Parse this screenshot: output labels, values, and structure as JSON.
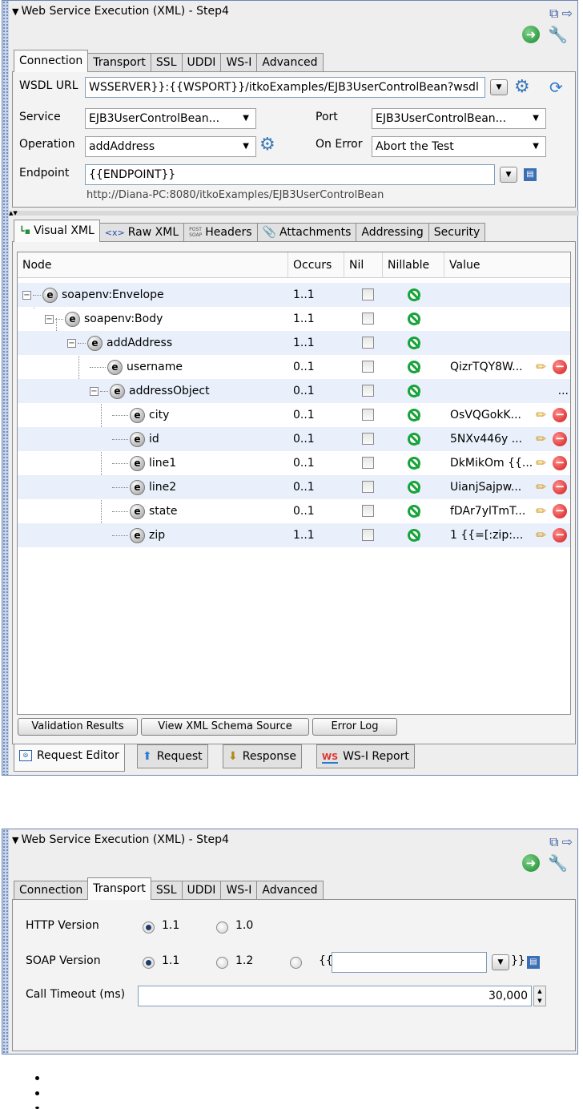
{
  "panel1": {
    "title": "Web Service Execution (XML) - Step4",
    "tabs": [
      "Connection",
      "Transport",
      "SSL",
      "UDDI",
      "WS-I",
      "Advanced"
    ],
    "active_tab": "Connection",
    "wsdl_label": "WSDL URL",
    "wsdl_value": "WSSERVER}}:{{WSPORT}}/itkoExamples/EJB3UserControlBean?wsdl",
    "service_label": "Service",
    "service_value": "EJB3UserControlBean...",
    "port_label": "Port",
    "port_value": "EJB3UserControlBean...",
    "operation_label": "Operation",
    "operation_value": "addAddress",
    "on_error_label": "On Error",
    "on_error_value": "Abort the Test",
    "endpoint_label": "Endpoint",
    "endpoint_value": "{{ENDPOINT}}",
    "endpoint_url": "http://Diana-PC:8080/itkoExamples/EJB3UserControlBean",
    "inner_tabs": [
      "Visual XML",
      "Raw XML",
      "Headers",
      "Attachments",
      "Addressing",
      "Security"
    ],
    "inner_tab_icons": {
      "raw_xml": "<x>",
      "headers_top": "POST",
      "headers_bottom": "SOAP"
    },
    "columns": [
      "Node",
      "Occurs",
      "Nil",
      "Nillable",
      "Value"
    ],
    "rows": [
      {
        "node": "soapenv:Envelope",
        "occurs": "1..1",
        "value": ""
      },
      {
        "node": "soapenv:Body",
        "occurs": "1..1",
        "value": ""
      },
      {
        "node": "addAddress",
        "occurs": "1..1",
        "value": ""
      },
      {
        "node": "username",
        "occurs": "0..1",
        "value": "QizrTQY8W..."
      },
      {
        "node": "addressObject",
        "occurs": "0..1",
        "value": "..."
      },
      {
        "node": "city",
        "occurs": "0..1",
        "value": "OsVQGokK..."
      },
      {
        "node": "id",
        "occurs": "0..1",
        "value": "5NXv446y ..."
      },
      {
        "node": "line1",
        "occurs": "0..1",
        "value": "DkMikOm {{..."
      },
      {
        "node": "line2",
        "occurs": "0..1",
        "value": "UianjSajpw..."
      },
      {
        "node": "state",
        "occurs": "0..1",
        "value": "fDAr7ylTmT..."
      },
      {
        "node": "zip",
        "occurs": "1..1",
        "value": "1 {{=[:zip:..."
      }
    ],
    "element_glyph": "e",
    "buttons": [
      "Validation Results",
      "View XML Schema Source",
      "Error Log"
    ],
    "bottom_tabs": [
      "Request Editor",
      "Request",
      "Response",
      "WS-I Report"
    ],
    "ws_icon_text": "WS"
  },
  "panel2": {
    "title": "Web Service Execution (XML) - Step4",
    "tabs": [
      "Connection",
      "Transport",
      "SSL",
      "UDDI",
      "WS-I",
      "Advanced"
    ],
    "active_tab": "Transport",
    "http_label": "HTTP Version",
    "http_options": [
      "1.1",
      "1.0"
    ],
    "http_selected": "1.1",
    "soap_label": "SOAP Version",
    "soap_options": [
      "1.1",
      "1.2"
    ],
    "soap_selected": "1.1",
    "soap_custom_prefix": "{{",
    "soap_custom_suffix": "}}",
    "timeout_label": "Call Timeout (ms)",
    "timeout_value": "30,000"
  },
  "icons": {
    "go": "go-arrow-icon",
    "wrench": "wrench-icon",
    "restore": "restore-window-icon",
    "dock": "dock-arrow-icon"
  },
  "colors": {
    "panel_border": "#6d86b4",
    "row_alt": "#e9f0fb",
    "nillable_green": "#17a33a",
    "delete_red": "#d11b1b"
  }
}
